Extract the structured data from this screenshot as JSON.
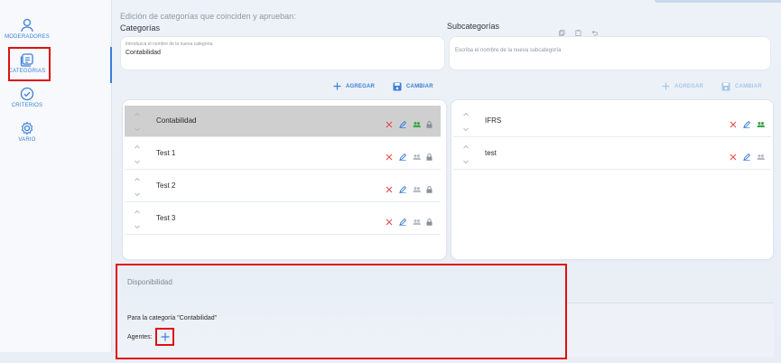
{
  "sidebar": {
    "items": [
      {
        "label": "MODERADORES",
        "icon": "user-icon"
      },
      {
        "label": "CATEGORIAS",
        "icon": "list-icon"
      },
      {
        "label": "CRITERIOS",
        "icon": "check-circle-icon"
      },
      {
        "label": "VARIO",
        "icon": "gear-icon"
      }
    ]
  },
  "main": {
    "heading": "Edición de categorías que coinciden y aprueban:",
    "categories": {
      "title": "Categorías",
      "input_label": "Introduzca el nombre de la nueva categoría",
      "input_value": "Contabilidad",
      "add_label": "AGREGAR",
      "change_label": "CAMBIAR",
      "items": [
        {
          "name": "Contabilidad",
          "selected": true
        },
        {
          "name": "Test 1",
          "selected": false
        },
        {
          "name": "Test 2",
          "selected": false
        },
        {
          "name": "Test 3",
          "selected": false
        }
      ]
    },
    "subcategories": {
      "title": "Subcategorías",
      "input_placeholder": "Escriba el nombre de la nueva subcategoría",
      "add_label": "AGREGAR",
      "change_label": "CAMBIAR",
      "items": [
        {
          "name": "IFRS"
        },
        {
          "name": "test"
        }
      ]
    },
    "availability": {
      "title": "Disponibilidad",
      "for_category": "Para la categoría \"Contabilidad\"",
      "agents_label": "Agentes:"
    }
  },
  "colors": {
    "accent": "#3b7fd6",
    "delete": "#e34b4b",
    "group_active": "#3aa64a",
    "highlight_border": "#e01010"
  }
}
